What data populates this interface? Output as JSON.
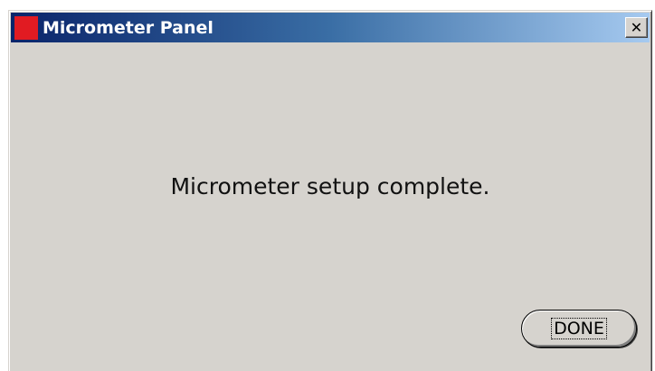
{
  "window": {
    "title": "Micrometer Panel",
    "icon": "oracle-icon",
    "close_label": "✕"
  },
  "main": {
    "message": "Micrometer setup complete."
  },
  "actions": {
    "done_label": "DONE"
  },
  "colors": {
    "titlebar_start": "#0a246a",
    "titlebar_end": "#a6caf0",
    "window_bg": "#d6d3ce",
    "icon_red": "#e11b22"
  }
}
